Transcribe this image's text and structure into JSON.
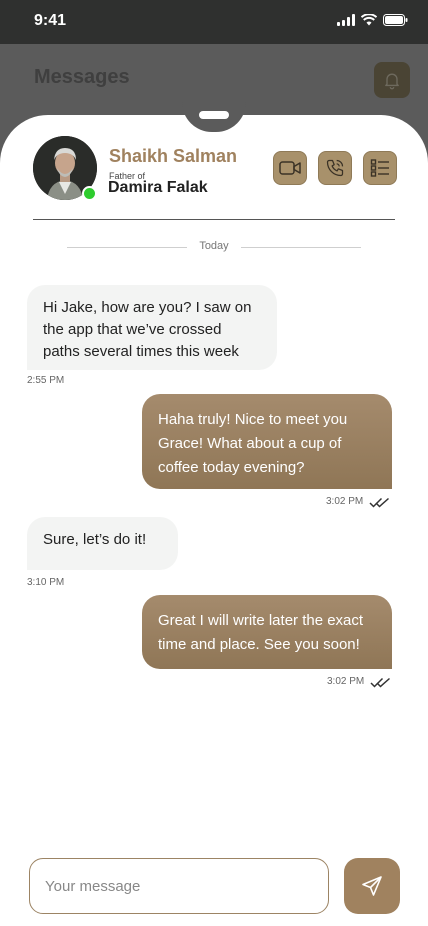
{
  "status_bar": {
    "time": "9:41"
  },
  "background_screen": {
    "title": "Messages"
  },
  "contact": {
    "name": "Shaikh Salman",
    "relation_label": "Father of",
    "child_name": "Damira Falak",
    "online": true
  },
  "chat": {
    "day_separator": "Today",
    "messages": [
      {
        "direction": "incoming",
        "text": "Hi Jake, how are you? I saw on the app that we’ve crossed paths several times this week",
        "time": "2:55 PM"
      },
      {
        "direction": "outgoing",
        "text": "Haha truly! Nice to meet you Grace! What about a cup of coffee today evening?",
        "time": "3:02 PM",
        "read": true
      },
      {
        "direction": "incoming",
        "text": "Sure, let’s do it!",
        "time": "3:10 PM"
      },
      {
        "direction": "outgoing",
        "text": "Great I will write later the exact time and place. See you soon!",
        "time": "3:02 PM",
        "read": true
      }
    ]
  },
  "composer": {
    "placeholder": "Your message",
    "value": ""
  },
  "colors": {
    "accent": "#a0825f",
    "online": "#2ecc2e",
    "incoming_bubble": "#f3f4f3"
  },
  "icons": [
    "signal-icon",
    "wifi-icon",
    "battery-icon",
    "bell-icon",
    "video-camera-icon",
    "phone-icon",
    "list-icon",
    "double-check-icon",
    "send-icon"
  ]
}
